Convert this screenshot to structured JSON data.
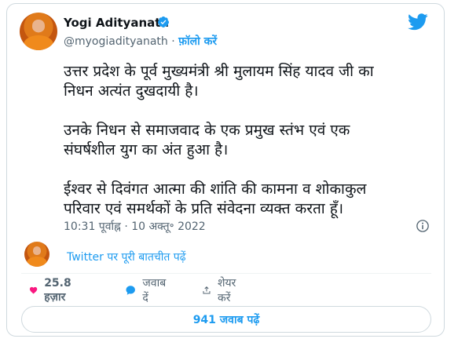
{
  "author": {
    "name": "Yogi Adityanath",
    "handle": "@myogiadityanath",
    "separator": "·",
    "follow_label": "फ़ॉलो करें"
  },
  "tweet": {
    "paragraphs": [
      "उत्तर प्रदेश के पूर्व मुख्यमंत्री श्री मुलायम सिंह यादव जी का\nनिधन अत्यंत दुखदायी है।",
      "उनके निधन से समाजवाद के एक प्रमुख स्तंभ एवं एक\nसंघर्षशील युग का अंत हुआ है।",
      "ईश्वर से दिवंगत आत्मा की शांति की कामना व शोकाकुल\nपरिवार एवं समर्थकों के प्रति संवेदना व्यक्त करता हूँ।"
    ],
    "timestamp": "10:31 पूर्वाह्न · 10 अक्तू॰ 2022"
  },
  "conversation_link": "Twitter पर पूरी बातचीत पढ़ें",
  "actions": {
    "likes": "25.8 हज़ार",
    "reply": "जवाब दें",
    "share": "शेयर करें"
  },
  "replies_button": "941 जवाब पढ़ें",
  "icons": {
    "verified": "verified-badge-icon",
    "logo": "twitter-bird-icon",
    "info": "info-icon",
    "like": "heart-icon",
    "reply": "reply-bubble-icon",
    "share": "share-icon"
  },
  "colors": {
    "accent": "#1d9bf0",
    "like": "#f91880",
    "text": "#0f1419",
    "muted": "#536471"
  }
}
